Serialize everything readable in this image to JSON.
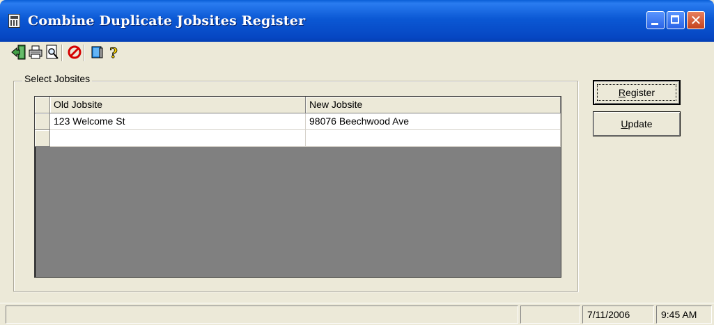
{
  "window": {
    "title": "Combine Duplicate Jobsites Register"
  },
  "toolbar": {
    "items": [
      {
        "name": "exit-icon"
      },
      {
        "name": "print-icon"
      },
      {
        "name": "print-preview-icon"
      },
      {
        "name": "cancel-icon"
      },
      {
        "name": "book-icon"
      },
      {
        "name": "help-icon"
      }
    ]
  },
  "group": {
    "label": "Select Jobsites"
  },
  "grid": {
    "columns": [
      "Old Jobsite",
      "New Jobsite"
    ],
    "rows": [
      [
        "123 Welcome St",
        "98076 Beechwood Ave"
      ],
      [
        "",
        ""
      ]
    ]
  },
  "buttons": {
    "register_prefix": "R",
    "register_rest": "egister",
    "update_prefix": "U",
    "update_rest": "pdate"
  },
  "statusbar": {
    "panel1": "",
    "panel2": "",
    "date": "7/11/2006",
    "time": "9:45 AM"
  },
  "colors": {
    "titlebar": "#0b58d4",
    "face": "#ECE9D8",
    "grid_bg": "#808080"
  }
}
